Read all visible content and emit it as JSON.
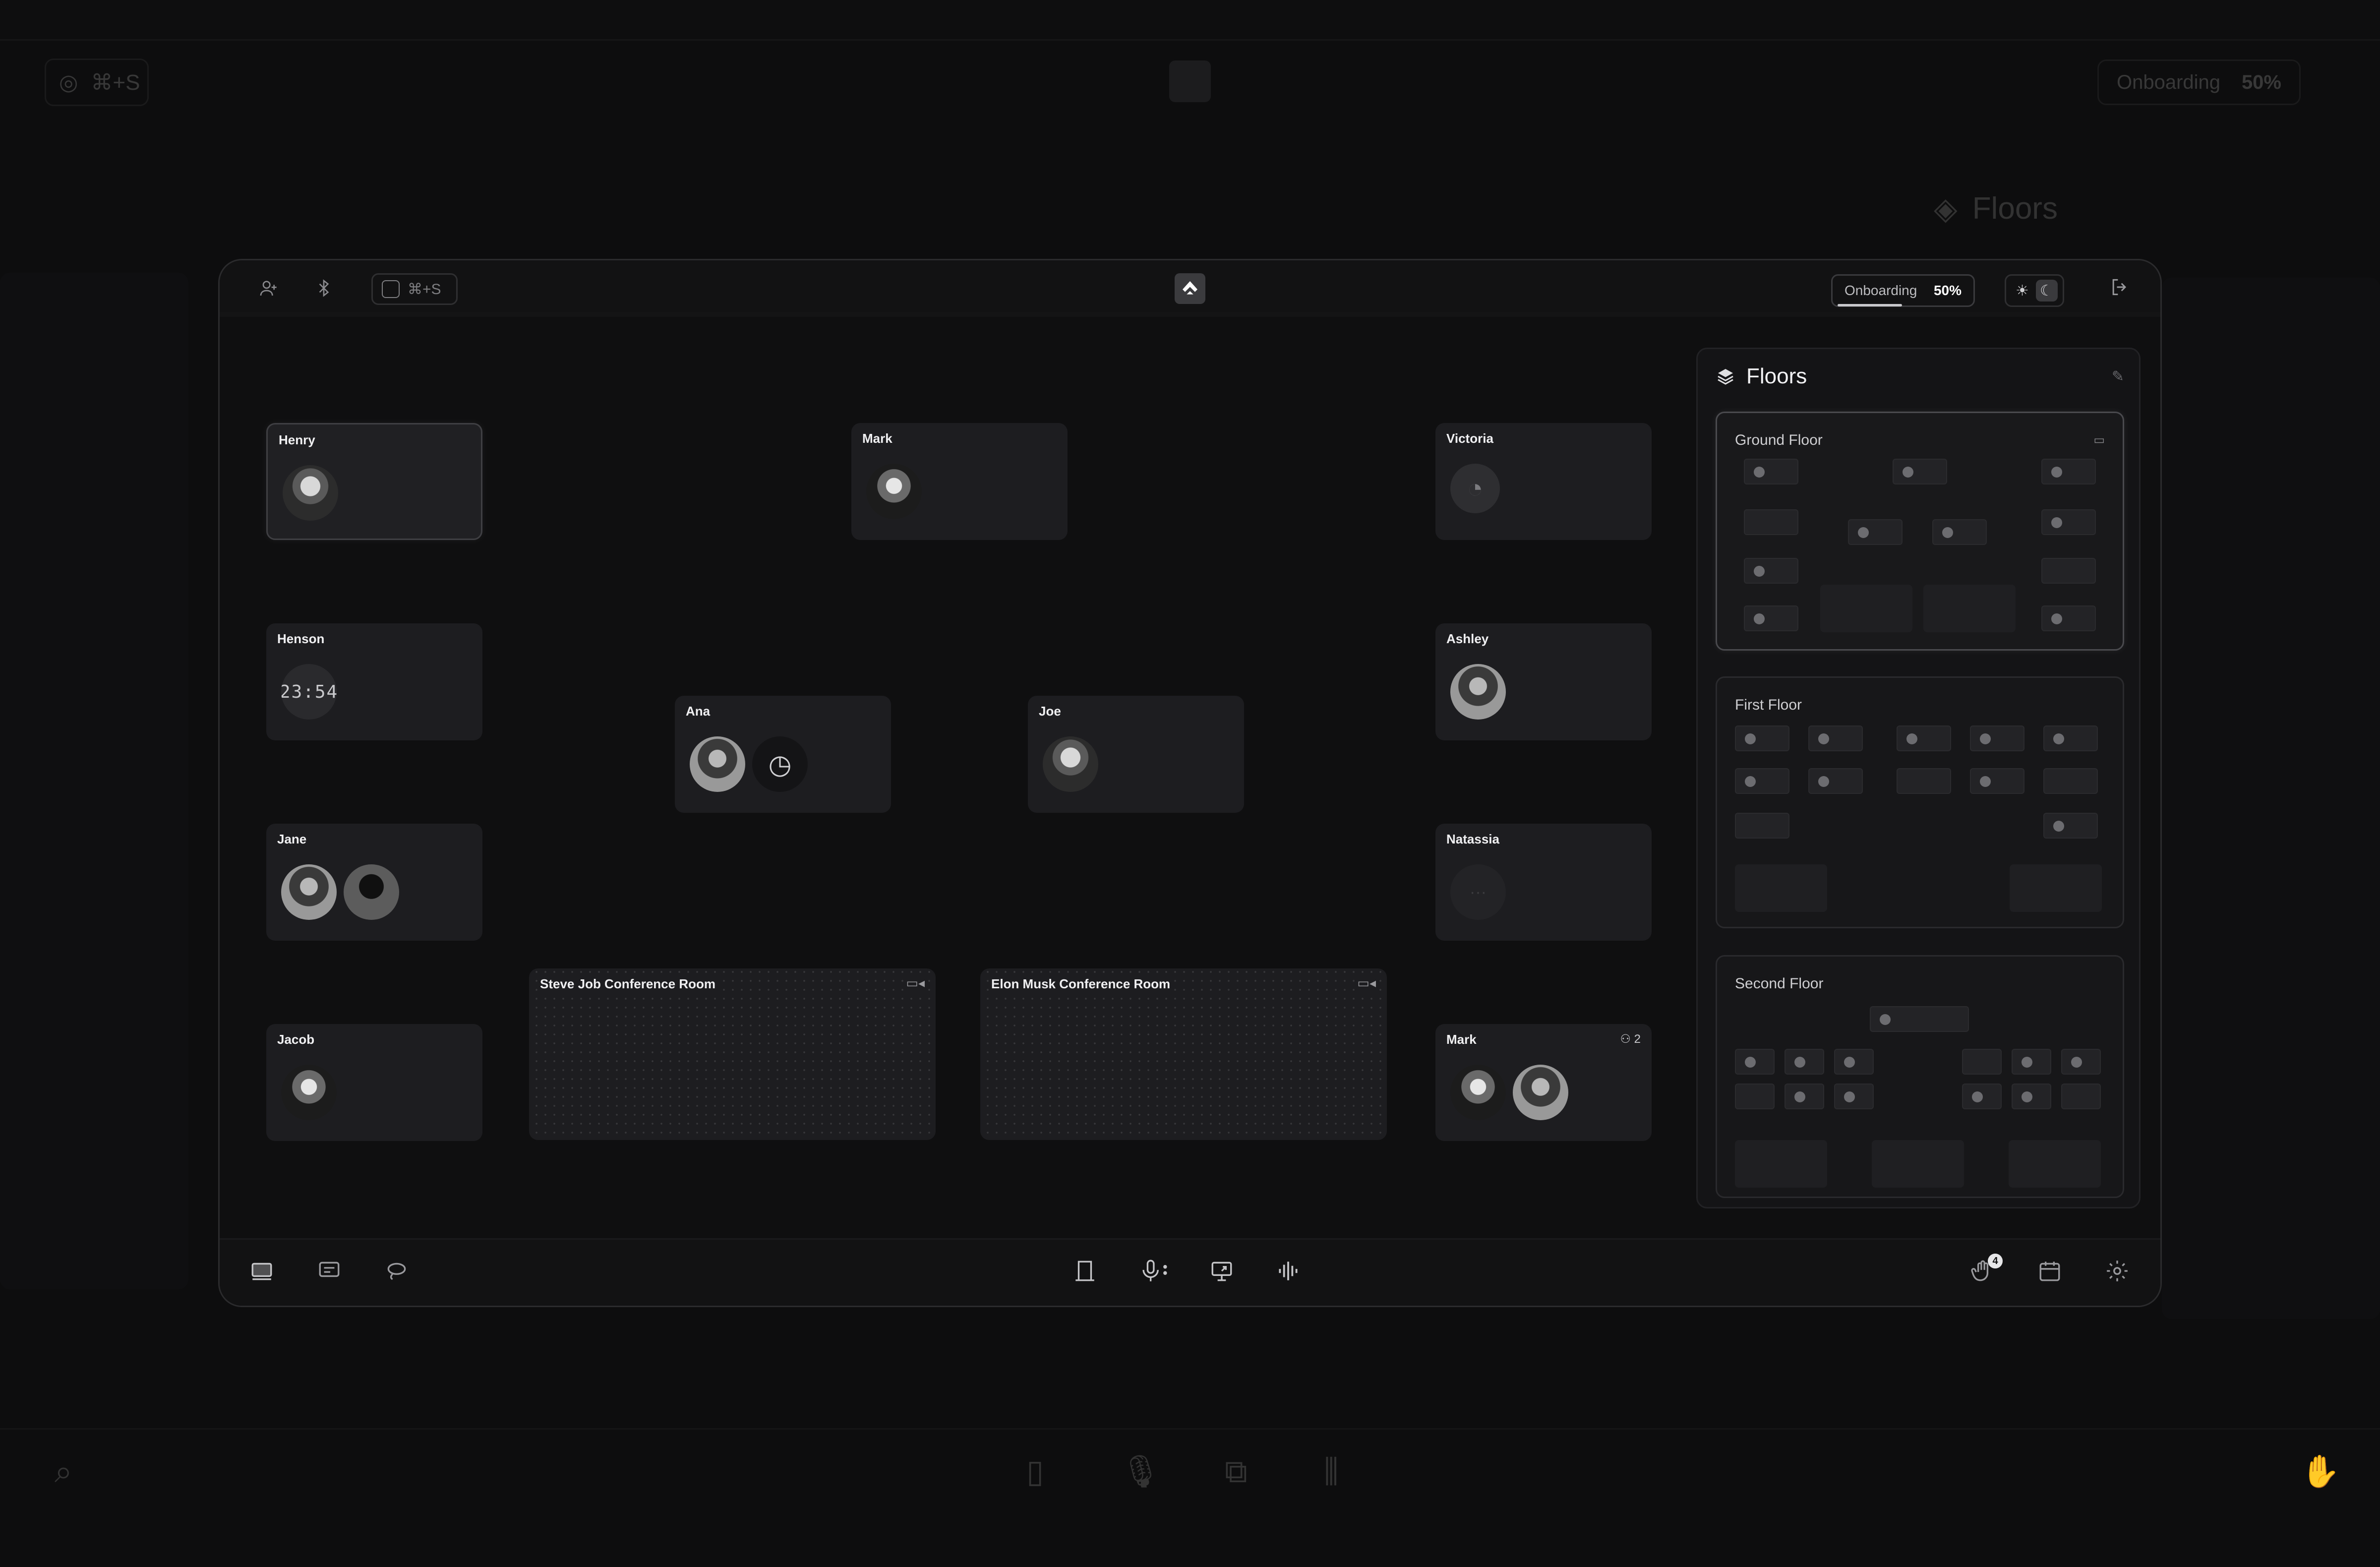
{
  "background": {
    "search_shortcut": "⌘+S",
    "onboarding_label": "Onboarding",
    "onboarding_value": "50%",
    "floors_title": "Floors"
  },
  "topbar": {
    "search_shortcut": "⌘+S",
    "onboarding_label": "Onboarding",
    "onboarding_value": "50%",
    "onboarding_progress": 0.5
  },
  "rooms": [
    {
      "name": "Henry"
    },
    {
      "name": "Mark"
    },
    {
      "name": "Victoria"
    },
    {
      "name": "Henson",
      "clock": "23:54"
    },
    {
      "name": "Ana"
    },
    {
      "name": "Joe"
    },
    {
      "name": "Ashley"
    },
    {
      "name": "Jane"
    },
    {
      "name": "Natassia",
      "status": "···"
    },
    {
      "name": "Jacob"
    },
    {
      "name": "Mark",
      "count": "2"
    }
  ],
  "conference_rooms": [
    {
      "name": "Steve Job Conference Room"
    },
    {
      "name": "Elon Musk Conference Room"
    }
  ],
  "floors_panel": {
    "title": "Floors",
    "floors": [
      {
        "name": "Ground Floor"
      },
      {
        "name": "First Floor"
      },
      {
        "name": "Second Floor"
      }
    ]
  },
  "dock": {
    "notifications_badge": "4"
  },
  "icons": [
    "add-user-icon",
    "bluetooth-icon",
    "search-icon",
    "logo-icon",
    "sun-icon",
    "moon-icon",
    "logout-icon",
    "layers-icon",
    "pin-icon",
    "video-icon",
    "users-icon",
    "screen-icon",
    "chat-icon",
    "lasso-icon",
    "door-icon",
    "mic-icon",
    "share-screen-icon",
    "audio-icon",
    "hand-icon",
    "calendar-icon",
    "gear-icon"
  ]
}
